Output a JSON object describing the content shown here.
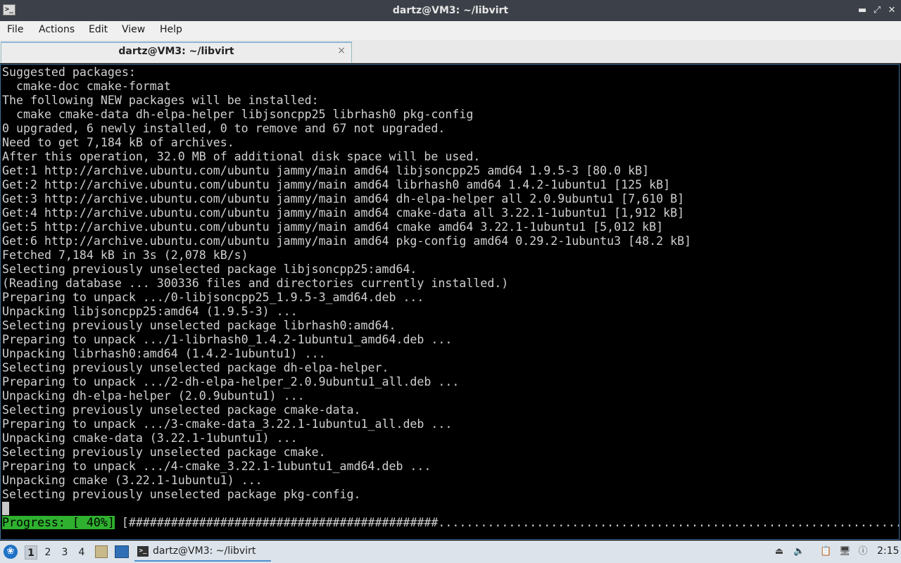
{
  "window": {
    "title": "dartz@VM3: ~/libvirt",
    "icon": "terminal-icon",
    "controls": [
      "minimize-icon",
      "maximize-icon",
      "close-icon"
    ]
  },
  "menu": {
    "file": "File",
    "actions": "Actions",
    "edit": "Edit",
    "view": "View",
    "help": "Help"
  },
  "tab": {
    "title": "dartz@VM3: ~/libvirt",
    "close": "×"
  },
  "terminal": {
    "lines": [
      "Suggested packages:",
      "  cmake-doc cmake-format",
      "The following NEW packages will be installed:",
      "  cmake cmake-data dh-elpa-helper libjsoncpp25 librhash0 pkg-config",
      "0 upgraded, 6 newly installed, 0 to remove and 67 not upgraded.",
      "Need to get 7,184 kB of archives.",
      "After this operation, 32.0 MB of additional disk space will be used.",
      "Get:1 http://archive.ubuntu.com/ubuntu jammy/main amd64 libjsoncpp25 amd64 1.9.5-3 [80.0 kB]",
      "Get:2 http://archive.ubuntu.com/ubuntu jammy/main amd64 librhash0 amd64 1.4.2-1ubuntu1 [125 kB]",
      "Get:3 http://archive.ubuntu.com/ubuntu jammy/main amd64 dh-elpa-helper all 2.0.9ubuntu1 [7,610 B]",
      "Get:4 http://archive.ubuntu.com/ubuntu jammy/main amd64 cmake-data all 3.22.1-1ubuntu1 [1,912 kB]",
      "Get:5 http://archive.ubuntu.com/ubuntu jammy/main amd64 cmake amd64 3.22.1-1ubuntu1 [5,012 kB]",
      "Get:6 http://archive.ubuntu.com/ubuntu jammy/main amd64 pkg-config amd64 0.29.2-1ubuntu3 [48.2 kB]",
      "Fetched 7,184 kB in 3s (2,078 kB/s)",
      "Selecting previously unselected package libjsoncpp25:amd64.",
      "(Reading database ... 300336 files and directories currently installed.)",
      "Preparing to unpack .../0-libjsoncpp25_1.9.5-3_amd64.deb ...",
      "Unpacking libjsoncpp25:amd64 (1.9.5-3) ...",
      "Selecting previously unselected package librhash0:amd64.",
      "Preparing to unpack .../1-librhash0_1.4.2-1ubuntu1_amd64.deb ...",
      "Unpacking librhash0:amd64 (1.4.2-1ubuntu1) ...",
      "Selecting previously unselected package dh-elpa-helper.",
      "Preparing to unpack .../2-dh-elpa-helper_2.0.9ubuntu1_all.deb ...",
      "Unpacking dh-elpa-helper (2.0.9ubuntu1) ...",
      "Selecting previously unselected package cmake-data.",
      "Preparing to unpack .../3-cmake-data_3.22.1-1ubuntu1_all.deb ...",
      "Unpacking cmake-data (3.22.1-1ubuntu1) ...",
      "Selecting previously unselected package cmake.",
      "Preparing to unpack .../4-cmake_3.22.1-1ubuntu1_amd64.deb ...",
      "Unpacking cmake (3.22.1-1ubuntu1) ...",
      "Selecting previously unselected package pkg-config."
    ],
    "progress_label": "Progress: [ 40%]",
    "progress_bar": " [############################################...................................................................]",
    "progress_percent": 40
  },
  "taskbar": {
    "start_icon": "start-menu-icon",
    "workspaces": [
      "1",
      "2",
      "3",
      "4"
    ],
    "active_workspace": "1",
    "launchers": [
      "file-manager-icon",
      "show-desktop-icon"
    ],
    "task_label": "dartz@VM3: ~/libvirt",
    "tray_icons": [
      "removable-drive-icon",
      "volume-icon",
      "clipboard-icon",
      "network-icon",
      "notification-icon"
    ],
    "clock": "2:15"
  },
  "colors": {
    "terminal_bg": "#000000",
    "terminal_fg": "#d0d0d0",
    "progress_bg": "#2fb12f",
    "titlebar_bg": "#3c4048"
  }
}
